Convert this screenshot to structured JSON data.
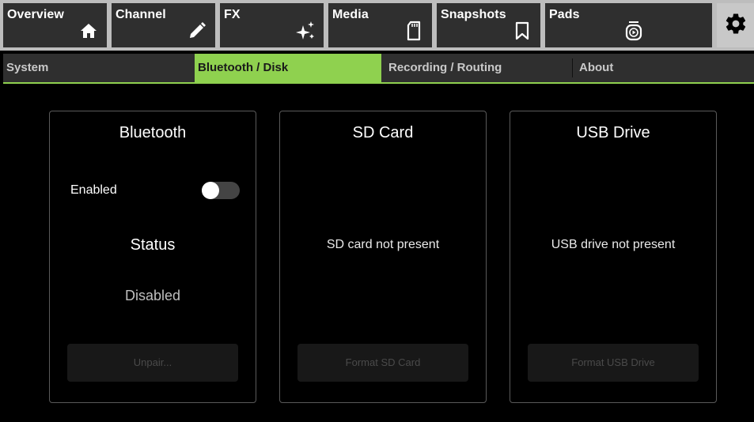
{
  "top_tabs": [
    {
      "label": "Overview",
      "icon": "home-icon"
    },
    {
      "label": "Channel",
      "icon": "pencil-icon"
    },
    {
      "label": "FX",
      "icon": "sparkle-icon"
    },
    {
      "label": "Media",
      "icon": "sd-card-icon"
    },
    {
      "label": "Snapshots",
      "icon": "bookmark-icon"
    },
    {
      "label": "Pads",
      "icon": "play-pad-icon"
    }
  ],
  "settings_icon": "gear-icon",
  "sub_tabs": [
    {
      "label": "System",
      "active": false
    },
    {
      "label": "Bluetooth / Disk",
      "active": true
    },
    {
      "label": "Recording / Routing",
      "active": false
    },
    {
      "label": "About",
      "active": false
    }
  ],
  "bluetooth": {
    "title": "Bluetooth",
    "enabled_label": "Enabled",
    "enabled": false,
    "status_title": "Status",
    "status_value": "Disabled",
    "button_label": "Unpair..."
  },
  "sd_card": {
    "title": "SD Card",
    "message": "SD card not present",
    "button_label": "Format SD Card"
  },
  "usb_drive": {
    "title": "USB Drive",
    "message": "USB drive not present",
    "button_label": "Format USB Drive"
  },
  "colors": {
    "accent": "#8fd14f",
    "tab_bg": "#2f2f2f",
    "panel_border": "#5a5a5a"
  }
}
